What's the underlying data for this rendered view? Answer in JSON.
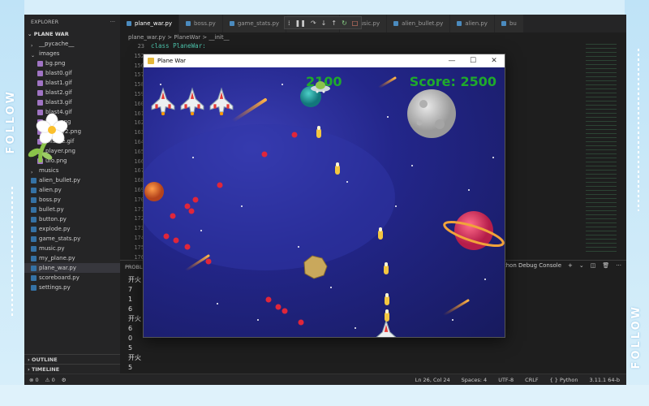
{
  "decor": {
    "follow_left": "FOLLOW",
    "follow_right": "FOLLOW"
  },
  "explorer": {
    "header": "EXPLORER",
    "more": "···",
    "project": "PLANE WAR",
    "items": [
      {
        "label": "__pycache__",
        "kind": "folder",
        "indent": 1
      },
      {
        "label": "images",
        "kind": "folder-open",
        "indent": 1
      },
      {
        "label": "bg.png",
        "kind": "img",
        "indent": 2
      },
      {
        "label": "blast0.gif",
        "kind": "img",
        "indent": 2
      },
      {
        "label": "blast1.gif",
        "kind": "img",
        "indent": 2
      },
      {
        "label": "blast2.gif",
        "kind": "img",
        "indent": 2
      },
      {
        "label": "blast3.gif",
        "kind": "img",
        "indent": 2
      },
      {
        "label": "blast4.gif",
        "kind": "img",
        "indent": 2
      },
      {
        "label": "boss.png",
        "kind": "img",
        "indent": 2
      },
      {
        "label": "enemy2.png",
        "kind": "img",
        "indent": 2
      },
      {
        "label": "missile.gif",
        "kind": "img",
        "indent": 2
      },
      {
        "label": "player.png",
        "kind": "img",
        "indent": 2
      },
      {
        "label": "ufo.png",
        "kind": "img",
        "indent": 2
      },
      {
        "label": "musics",
        "kind": "folder",
        "indent": 1
      },
      {
        "label": "alien_bullet.py",
        "kind": "py",
        "indent": 1
      },
      {
        "label": "alien.py",
        "kind": "py",
        "indent": 1
      },
      {
        "label": "boss.py",
        "kind": "py",
        "indent": 1
      },
      {
        "label": "bullet.py",
        "kind": "py",
        "indent": 1
      },
      {
        "label": "button.py",
        "kind": "py",
        "indent": 1
      },
      {
        "label": "explode.py",
        "kind": "py",
        "indent": 1
      },
      {
        "label": "game_stats.py",
        "kind": "py",
        "indent": 1
      },
      {
        "label": "music.py",
        "kind": "py",
        "indent": 1
      },
      {
        "label": "my_plane.py",
        "kind": "py",
        "indent": 1
      },
      {
        "label": "plane_war.py",
        "kind": "py",
        "indent": 1,
        "active": true
      },
      {
        "label": "scoreboard.py",
        "kind": "py",
        "indent": 1
      },
      {
        "label": "settings.py",
        "kind": "py",
        "indent": 1
      }
    ],
    "outline": "OUTLINE",
    "timeline": "TIMELINE"
  },
  "tabs": [
    {
      "label": "plane_war.py",
      "active": true
    },
    {
      "label": "boss.py"
    },
    {
      "label": "game_stats.py"
    },
    {
      "label": "explode.py"
    },
    {
      "label": "music.py"
    },
    {
      "label": "alien_bullet.py"
    },
    {
      "label": "alien.py"
    },
    {
      "label": "bu"
    }
  ],
  "breadcrumb": {
    "file": "plane_war.py",
    "sep1": ">",
    "cls": "PlaneWar",
    "sep2": ">",
    "method": "__init__"
  },
  "gutter": [
    "23",
    "152",
    "156",
    "157",
    "158",
    "159",
    "160",
    "161",
    "162",
    "163",
    "164",
    "165",
    "166",
    "167",
    "168",
    "169",
    "170",
    "171",
    "172",
    "173",
    "174",
    "175",
    "176",
    "177",
    "178"
  ],
  "code_line": "class PlaneWar:",
  "panel": {
    "tab_label": "PROBL",
    "debug_console": "Python Debug Console",
    "terminal_lines": [
      "开火",
      "7",
      "1",
      "6",
      "开火",
      "6",
      "0",
      "5",
      "开火",
      "5",
      "开火",
      "5",
      "开火"
    ]
  },
  "statusbar": {
    "errors": "0",
    "warnings": "0",
    "position": "Ln 26, Col 24",
    "spaces": "Spaces: 4",
    "encoding": "UTF-8",
    "eol": "CRLF",
    "language": "Python",
    "version": "3.11.1 64-b"
  },
  "game": {
    "title": "Plane War",
    "minimize": "—",
    "maximize": "☐",
    "close": "✕",
    "hiscore": "2100",
    "score": "Score: 2500",
    "lives": 3
  },
  "colors": {
    "score_green": "#1faa2c",
    "bullet_red": "#e0263a",
    "missile_yellow": "#f3c640"
  }
}
